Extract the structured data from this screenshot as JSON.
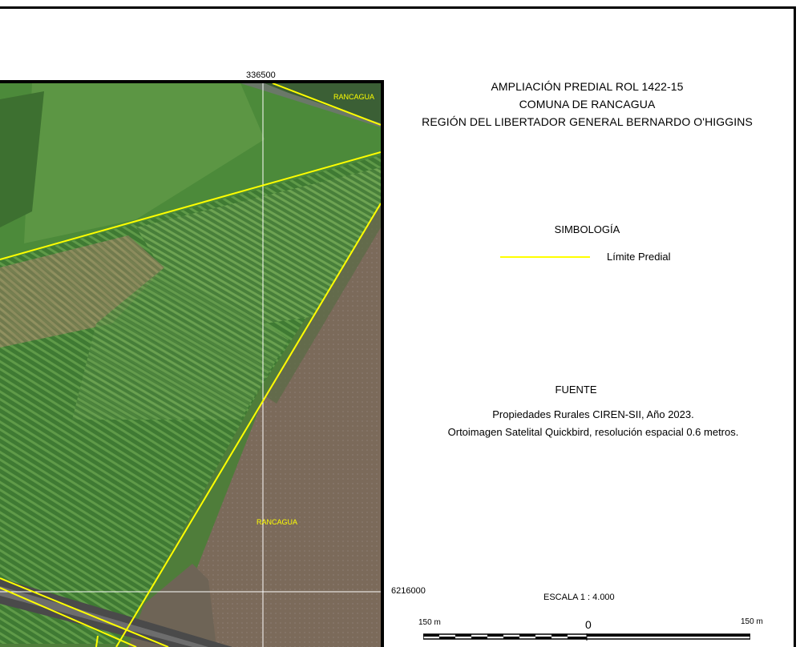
{
  "map": {
    "coord_x_label": "336500",
    "coord_y_label": "6216000",
    "place_labels": [
      "RANCAGUA",
      "RANCAGUA"
    ]
  },
  "title": {
    "line1": "AMPLIACIÓN PREDIAL ROL 1422-15",
    "line2": "COMUNA DE RANCAGUA",
    "line3": "REGIÓN DEL LIBERTADOR GENERAL BERNARDO O'HIGGINS"
  },
  "legend": {
    "heading": "SIMBOLOGÍA",
    "items": [
      {
        "label": "Límite Predial",
        "color": "#ffff00"
      }
    ]
  },
  "source": {
    "heading": "FUENTE",
    "lines": [
      "Propiedades Rurales CIREN-SII, Año 2023.",
      "Ortoimagen Satelital Quickbird, resolución espacial 0.6 metros."
    ]
  },
  "scale": {
    "label": "ESCALA  1 : 4.000",
    "left_label": "150 m",
    "center_label": "0",
    "right_label": "150 m"
  }
}
